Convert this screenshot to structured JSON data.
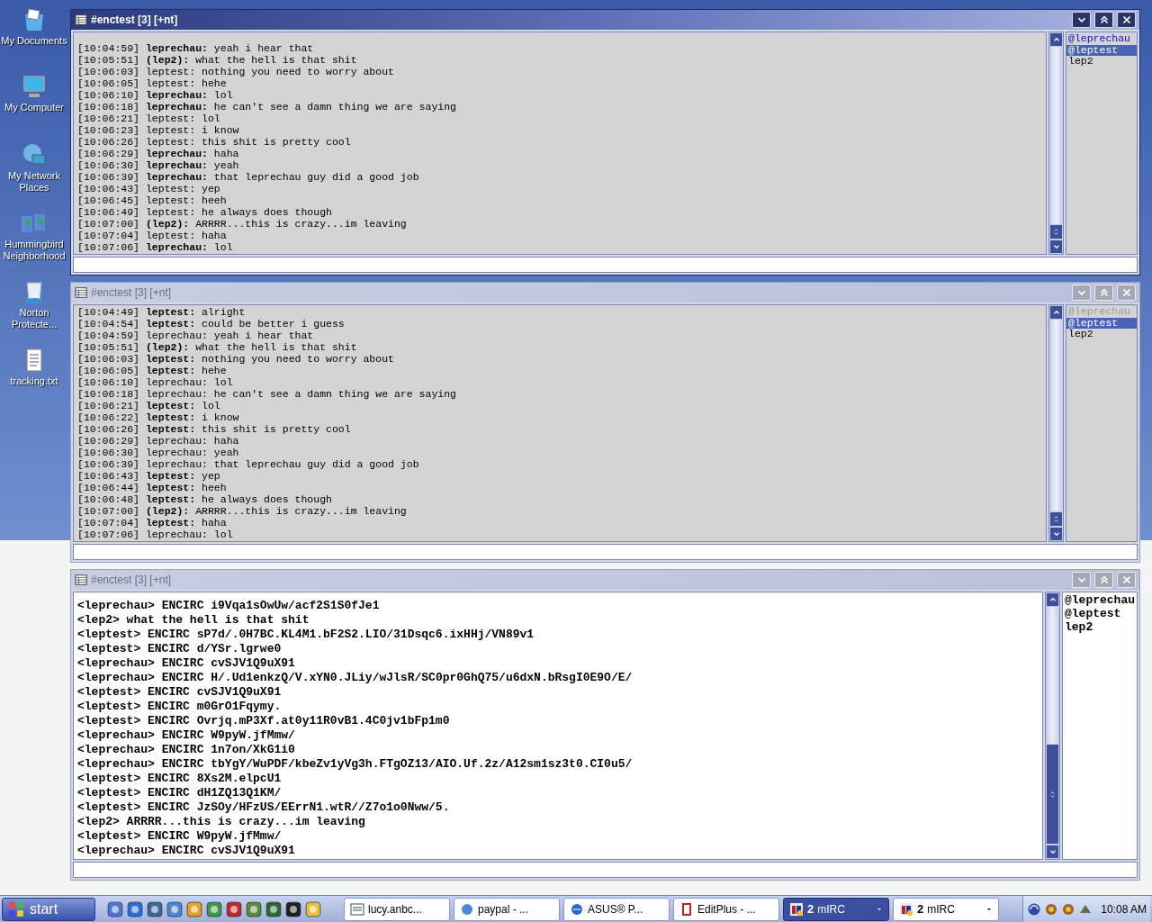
{
  "desktop_icons": [
    {
      "label": "My Documents"
    },
    {
      "label": "My Computer"
    },
    {
      "label": "My Network Places"
    },
    {
      "label": "Hummingbird Neighborhood"
    },
    {
      "label": "Norton Protecte..."
    },
    {
      "label": "tracking.txt"
    }
  ],
  "windows": [
    {
      "title": "#enctest [3] [+nt]",
      "active": true,
      "kind": "timestamped",
      "lines": [
        {
          "time": "[10:04:59]",
          "nick": "leprechau:",
          "bold": true,
          "text": "yeah i hear that"
        },
        {
          "time": "[10:05:51]",
          "nick": "(lep2):",
          "bold": true,
          "text": "what the hell is that shit"
        },
        {
          "time": "[10:06:03]",
          "nick": "leptest:",
          "bold": false,
          "text": "nothing you need to worry about"
        },
        {
          "time": "[10:06:05]",
          "nick": "leptest:",
          "bold": false,
          "text": "hehe"
        },
        {
          "time": "[10:06:10]",
          "nick": "leprechau:",
          "bold": true,
          "text": "lol"
        },
        {
          "time": "[10:06:18]",
          "nick": "leprechau:",
          "bold": true,
          "text": "he can't see a damn thing we are saying"
        },
        {
          "time": "[10:06:21]",
          "nick": "leptest:",
          "bold": false,
          "text": "lol"
        },
        {
          "time": "[10:06:23]",
          "nick": "leptest:",
          "bold": false,
          "text": "i know"
        },
        {
          "time": "[10:06:26]",
          "nick": "leptest:",
          "bold": false,
          "text": "this shit is pretty cool"
        },
        {
          "time": "[10:06:29]",
          "nick": "leprechau:",
          "bold": true,
          "text": "haha"
        },
        {
          "time": "[10:06:30]",
          "nick": "leprechau:",
          "bold": true,
          "text": "yeah"
        },
        {
          "time": "[10:06:39]",
          "nick": "leprechau:",
          "bold": true,
          "text": "that leprechau guy did a good job"
        },
        {
          "time": "[10:06:43]",
          "nick": "leptest:",
          "bold": false,
          "text": "yep"
        },
        {
          "time": "[10:06:45]",
          "nick": "leptest:",
          "bold": false,
          "text": "heeh"
        },
        {
          "time": "[10:06:49]",
          "nick": "leptest:",
          "bold": false,
          "text": "he always does though"
        },
        {
          "time": "[10:07:00]",
          "nick": "(lep2):",
          "bold": true,
          "text": "ARRRR...this is crazy...im leaving"
        },
        {
          "time": "[10:07:04]",
          "nick": "leptest:",
          "bold": false,
          "text": "haha"
        },
        {
          "time": "[10:07:06]",
          "nick": "leprechau:",
          "bold": true,
          "text": "lol"
        }
      ],
      "nicks": [
        {
          "name": "@leprechau",
          "selected": false,
          "color": "#1010c0"
        },
        {
          "name": "@leptest",
          "selected": true
        },
        {
          "name": "lep2",
          "selected": false,
          "color": "#000000"
        }
      ]
    },
    {
      "title": "#enctest [3] [+nt]",
      "active": false,
      "kind": "timestamped",
      "lines": [
        {
          "time": "[10:04:49]",
          "nick": "leptest:",
          "bold": true,
          "text": "alright"
        },
        {
          "time": "[10:04:54]",
          "nick": "leptest:",
          "bold": true,
          "text": "could be better i guess"
        },
        {
          "time": "[10:04:59]",
          "nick": "leprechau:",
          "bold": false,
          "text": "yeah i hear that"
        },
        {
          "time": "[10:05:51]",
          "nick": "(lep2):",
          "bold": true,
          "text": "what the hell is that shit"
        },
        {
          "time": "[10:06:03]",
          "nick": "leptest:",
          "bold": true,
          "text": "nothing you need to worry about"
        },
        {
          "time": "[10:06:05]",
          "nick": "leptest:",
          "bold": true,
          "text": "hehe"
        },
        {
          "time": "[10:06:10]",
          "nick": "leprechau:",
          "bold": false,
          "text": "lol"
        },
        {
          "time": "[10:06:18]",
          "nick": "leprechau:",
          "bold": false,
          "text": "he can't see a damn thing we are saying"
        },
        {
          "time": "[10:06:21]",
          "nick": "leptest:",
          "bold": true,
          "text": "lol"
        },
        {
          "time": "[10:06:22]",
          "nick": "leptest:",
          "bold": true,
          "text": "i know"
        },
        {
          "time": "[10:06:26]",
          "nick": "leptest:",
          "bold": true,
          "text": "this shit is pretty cool"
        },
        {
          "time": "[10:06:29]",
          "nick": "leprechau:",
          "bold": false,
          "text": "haha"
        },
        {
          "time": "[10:06:30]",
          "nick": "leprechau:",
          "bold": false,
          "text": "yeah"
        },
        {
          "time": "[10:06:39]",
          "nick": "leprechau:",
          "bold": false,
          "text": "that leprechau guy did a good job"
        },
        {
          "time": "[10:06:43]",
          "nick": "leptest:",
          "bold": true,
          "text": "yep"
        },
        {
          "time": "[10:06:44]",
          "nick": "leptest:",
          "bold": true,
          "text": "heeh"
        },
        {
          "time": "[10:06:48]",
          "nick": "leptest:",
          "bold": true,
          "text": "he always does though"
        },
        {
          "time": "[10:07:00]",
          "nick": "(lep2):",
          "bold": true,
          "text": "ARRRR...this is crazy...im leaving"
        },
        {
          "time": "[10:07:04]",
          "nick": "leptest:",
          "bold": true,
          "text": "haha"
        },
        {
          "time": "[10:07:06]",
          "nick": "leprechau:",
          "bold": false,
          "text": "lol"
        }
      ],
      "nicks": [
        {
          "name": "@leprechau",
          "selected": false,
          "color": "#9a9a9a"
        },
        {
          "name": "@leptest",
          "selected": true
        },
        {
          "name": "lep2",
          "selected": false,
          "color": "#000000"
        }
      ]
    },
    {
      "title": "#enctest [3] [+nt]",
      "active": false,
      "kind": "plain",
      "lines": [
        {
          "nick": "<leprechau>",
          "text": "ENCIRC i9Vqa1sOwUw/acf2S1S0fJe1"
        },
        {
          "nick": "<lep2>",
          "text": "what the hell is that shit"
        },
        {
          "nick": "<leptest>",
          "text": "ENCIRC sP7d/.0H7BC.KL4M1.bF2S2.LIO/31Dsqc6.ixHHj/VN89v1"
        },
        {
          "nick": "<leptest>",
          "text": "ENCIRC d/YSr.lgrwe0"
        },
        {
          "nick": "<leprechau>",
          "text": "ENCIRC cvSJV1Q9uX91"
        },
        {
          "nick": "<leprechau>",
          "text": "ENCIRC H/.Ud1enkzQ/V.xYN0.JLiy/wJlsR/SC0pr0GhQ75/u6dxN.bRsgI0E9O/E/"
        },
        {
          "nick": "<leptest>",
          "text": "ENCIRC cvSJV1Q9uX91"
        },
        {
          "nick": "<leptest>",
          "text": "ENCIRC m0GrO1Fqymy."
        },
        {
          "nick": "<leptest>",
          "text": "ENCIRC Ovrjq.mP3Xf.at0y11R0vB1.4C0jv1bFp1m0"
        },
        {
          "nick": "<leprechau>",
          "text": "ENCIRC W9pyW.jfMmw/"
        },
        {
          "nick": "<leprechau>",
          "text": "ENCIRC 1n7on/XkG1i0"
        },
        {
          "nick": "<leprechau>",
          "text": "ENCIRC tbYgY/WuPDF/kbeZv1yVg3h.FTgOZ13/AIO.Uf.2z/A12sm1sz3t0.CI0u5/"
        },
        {
          "nick": "<leptest>",
          "text": "ENCIRC 8Xs2M.elpcU1"
        },
        {
          "nick": "<leptest>",
          "text": "ENCIRC dH1ZQ13Q1KM/"
        },
        {
          "nick": "<leptest>",
          "text": "ENCIRC JzSOy/HFzUS/EErrN1.wtR//Z7o1o0Nww/5."
        },
        {
          "nick": "<lep2>",
          "text": "ARRRR...this is crazy...im leaving"
        },
        {
          "nick": "<leptest>",
          "text": "ENCIRC W9pyW.jfMmw/"
        },
        {
          "nick": "<leprechau>",
          "text": "ENCIRC cvSJV1Q9uX91"
        }
      ],
      "nicks": [
        {
          "name": "@leprechau",
          "selected": false,
          "color": "#000000"
        },
        {
          "name": "@leptest",
          "selected": false,
          "color": "#000000"
        },
        {
          "name": "lep2",
          "selected": false,
          "color": "#000000"
        }
      ]
    }
  ],
  "taskbar": {
    "start": "start",
    "tasks": [
      {
        "kind": "single",
        "label": "lucy.anbc...",
        "selected": false
      },
      {
        "kind": "single",
        "label": "paypal - ...",
        "selected": false
      },
      {
        "kind": "single",
        "label": "ASUS® P...",
        "selected": false
      },
      {
        "kind": "single",
        "label": "EditPlus - ...",
        "selected": false
      },
      {
        "kind": "group",
        "count": "2",
        "label": "mIRC",
        "selected": true
      },
      {
        "kind": "group",
        "count": "2",
        "label": "mIRC",
        "selected": false
      }
    ],
    "clock": "10:08 AM"
  }
}
